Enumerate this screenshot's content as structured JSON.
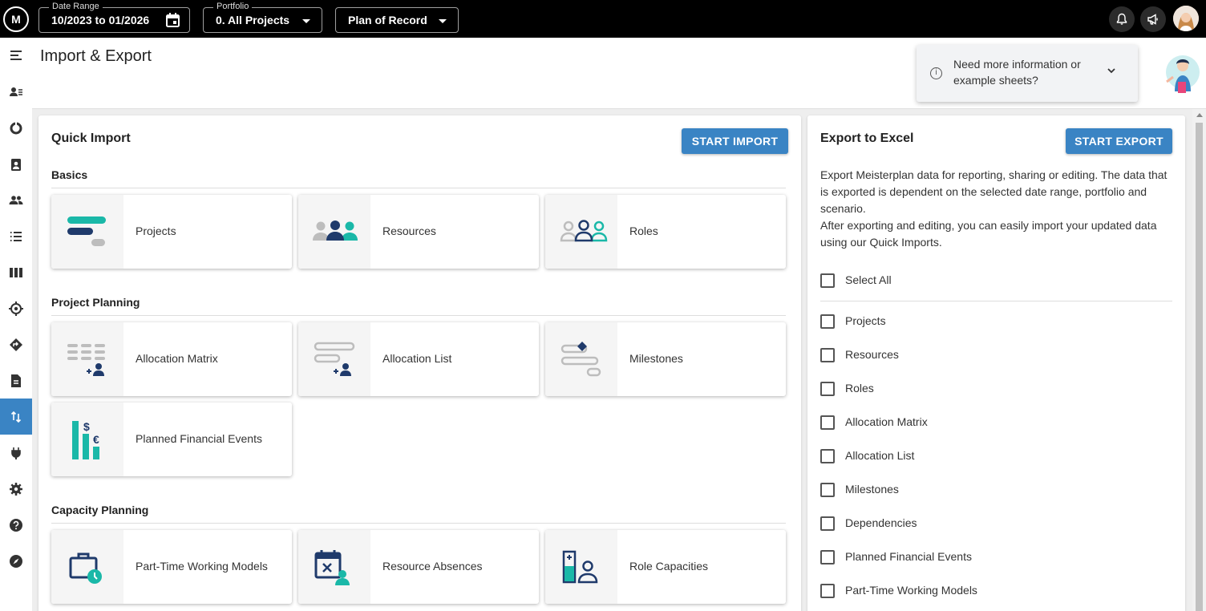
{
  "topbar": {
    "logo": "M",
    "date_range": {
      "label": "Date Range",
      "value": "10/2023 to 01/2026"
    },
    "portfolio": {
      "label": "Portfolio",
      "value": "0. All Projects"
    },
    "scenario": {
      "value": "Plan of Record"
    }
  },
  "page": {
    "title": "Import & Export"
  },
  "help": {
    "text": "Need more information or example sheets?"
  },
  "quick_import": {
    "title": "Quick Import",
    "button": "START IMPORT",
    "sections": {
      "basics": "Basics",
      "project_planning": "Project Planning",
      "capacity_planning": "Capacity Planning"
    },
    "cards": {
      "projects": "Projects",
      "resources": "Resources",
      "roles": "Roles",
      "allocation_matrix": "Allocation Matrix",
      "allocation_list": "Allocation List",
      "milestones": "Milestones",
      "planned_financial_events": "Planned Financial Events",
      "part_time_working_models": "Part-Time Working Models",
      "resource_absences": "Resource Absences",
      "role_capacities": "Role Capacities"
    }
  },
  "export": {
    "title": "Export to Excel",
    "button": "START EXPORT",
    "description_1": "Export Meisterplan data for reporting, sharing or editing. The data that is exported is dependent on the selected date range, portfolio and scenario.",
    "description_2": "After exporting and editing, you can easily import your updated data using our Quick Imports.",
    "select_all": "Select All",
    "options": [
      "Projects",
      "Resources",
      "Roles",
      "Allocation Matrix",
      "Allocation List",
      "Milestones",
      "Dependencies",
      "Planned Financial Events",
      "Part-Time Working Models"
    ]
  },
  "colors": {
    "accent": "#3a84c4",
    "teal": "#1ab8a8",
    "navy": "#1f3a6b"
  }
}
